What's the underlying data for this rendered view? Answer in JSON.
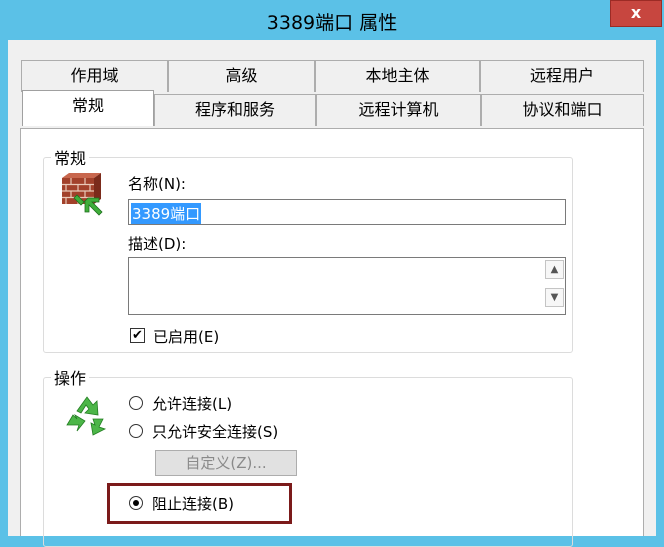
{
  "window": {
    "title": "3389端口 属性",
    "close_label": "x"
  },
  "tabs": {
    "row1": [
      "作用域",
      "高级",
      "本地主体",
      "远程用户"
    ],
    "row2": [
      "常规",
      "程序和服务",
      "远程计算机",
      "协议和端口"
    ],
    "active": "常规"
  },
  "general": {
    "group_label": "常规",
    "name_label": "名称(N):",
    "name_value": "3389端口",
    "desc_label": "描述(D):",
    "desc_value": "",
    "enabled_label": "已启用(E)",
    "enabled": true
  },
  "action": {
    "group_label": "操作",
    "options": [
      "允许连接(L)",
      "只允许安全连接(S)",
      "阻止连接(B)"
    ],
    "selected": "阻止连接(B)",
    "customize_label": "自定义(Z)..."
  },
  "colors": {
    "titlebar": "#5bc1e7",
    "close": "#c7463f",
    "highlight_box": "#7b1a1a",
    "selection": "#3399ff"
  },
  "icons": {
    "firewall": "firewall-brick-icon",
    "action": "green-recycle-arrows-icon"
  }
}
